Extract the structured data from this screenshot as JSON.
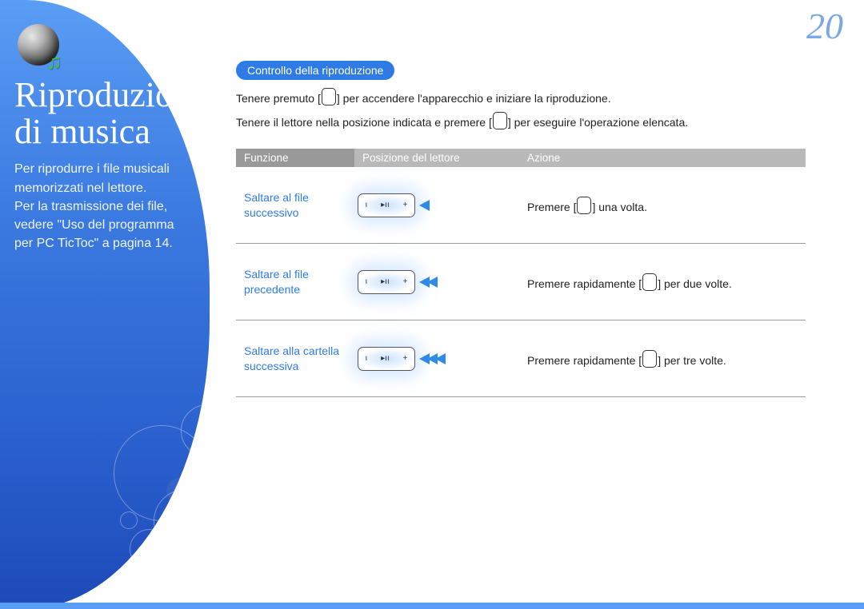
{
  "page_number": "20",
  "sidebar": {
    "title_line1": "Riproduzione",
    "title_line2": "di musica",
    "para1": "Per riprodurre i file musicali memorizzati nel lettore.",
    "para2": "Per la trasmissione dei file, vedere \"Uso del programma per PC TicToc\" a pagina 14."
  },
  "section_pill": "Controllo della riproduzione",
  "intro": {
    "line1_a": "Tenere premuto [",
    "line1_b": "] per accendere l'apparecchio e iniziare la riproduzione.",
    "line2_a": "Tenere il lettore nella posizione indicata e premere [",
    "line2_b": "] per eseguire l'operazione elencata."
  },
  "table": {
    "headers": {
      "func": "Funzione",
      "pos": "Posizione del lettore",
      "act": "Azione"
    },
    "rows": [
      {
        "func": "Saltare al file successivo",
        "arrows": 1,
        "act_a": "Premere [",
        "act_b": "] una volta."
      },
      {
        "func": "Saltare al file precedente",
        "arrows": 2,
        "act_a": "Premere rapidamente [",
        "act_b": "] per due volte."
      },
      {
        "func": "Saltare alla cartella successiva",
        "arrows": 3,
        "act_a": "Premere rapidamente [",
        "act_b": "] per tre volte."
      }
    ]
  }
}
